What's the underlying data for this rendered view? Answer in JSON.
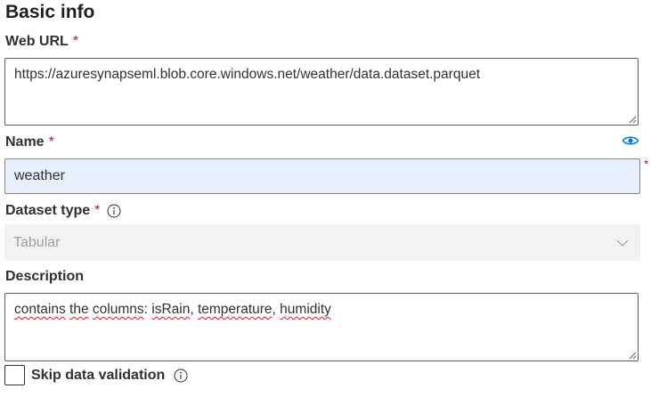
{
  "section": {
    "title": "Basic info"
  },
  "web_url": {
    "label": "Web URL",
    "required_mark": "*",
    "value": "https://azuresynapseml.blob.core.windows.net/weather/data.dataset.parquet"
  },
  "name": {
    "label": "Name",
    "required_mark": "*",
    "value": "weather",
    "field_required_mark": "*",
    "icon": "eye-icon"
  },
  "dataset_type": {
    "label": "Dataset type",
    "required_mark": "*",
    "info_icon": "info-icon",
    "selected": "Tabular"
  },
  "description": {
    "label": "Description",
    "words": [
      {
        "text": "contains",
        "misspelled": true
      },
      {
        "text": " ",
        "misspelled": false
      },
      {
        "text": "the",
        "misspelled": true
      },
      {
        "text": " ",
        "misspelled": false
      },
      {
        "text": "columns",
        "misspelled": true
      },
      {
        "text": ": ",
        "misspelled": false
      },
      {
        "text": "isRain",
        "misspelled": true
      },
      {
        "text": ", ",
        "misspelled": false
      },
      {
        "text": "temperature",
        "misspelled": true
      },
      {
        "text": ", ",
        "misspelled": false
      },
      {
        "text": "humidity",
        "misspelled": true
      }
    ]
  },
  "skip_validation": {
    "label": "Skip data validation",
    "checked": false,
    "info_icon": "info-icon"
  },
  "colors": {
    "required": "#a4262c",
    "autofill_bg": "#e8f0fe",
    "accent": "#0078d4",
    "disabled_bg": "#f3f2f1"
  }
}
